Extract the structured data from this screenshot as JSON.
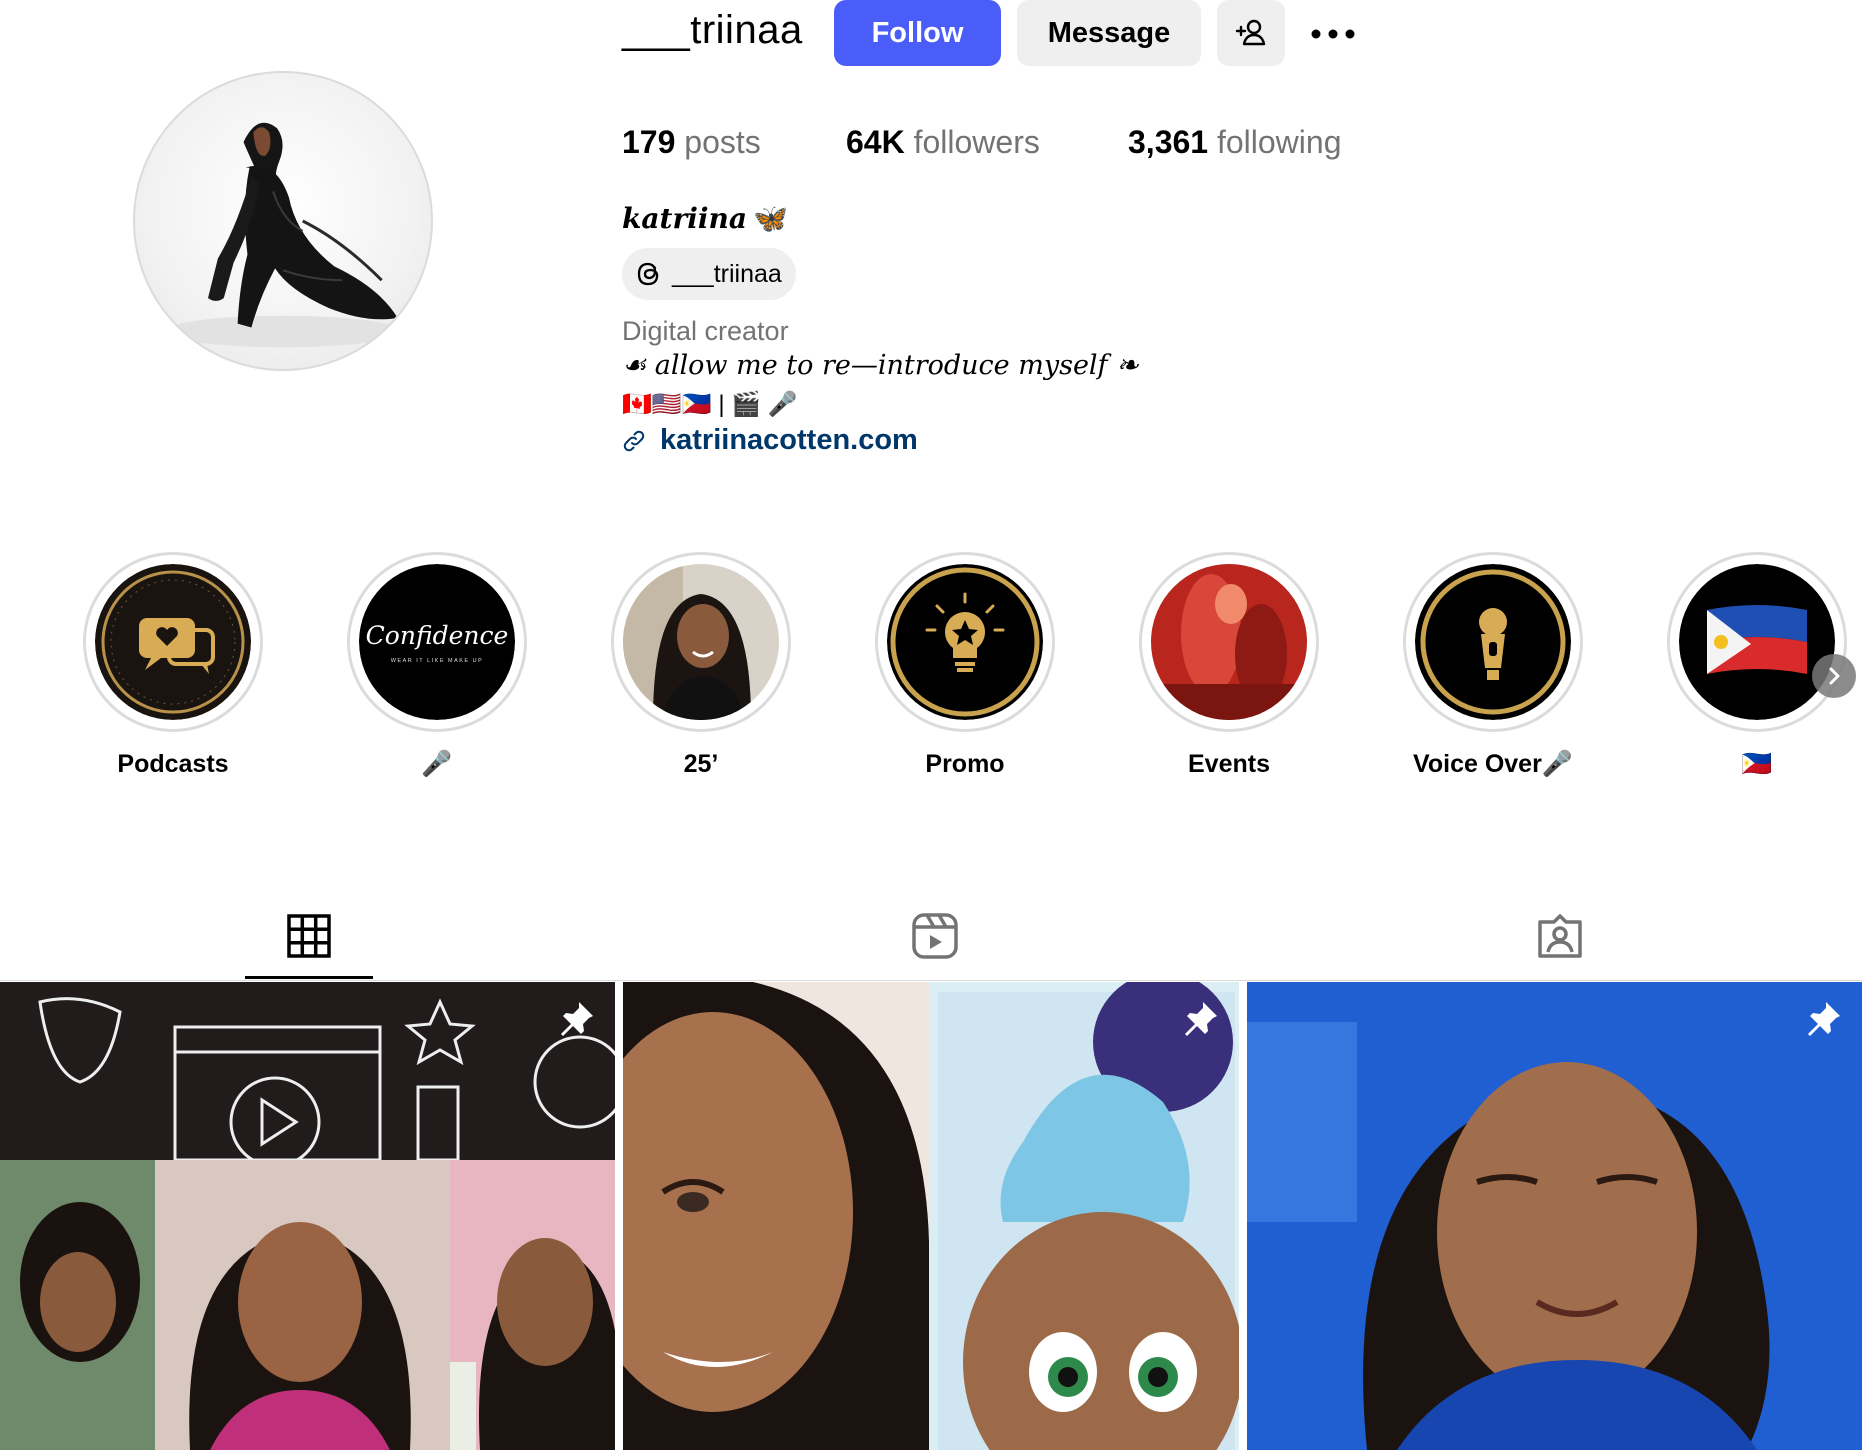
{
  "profile": {
    "username": "___triinaa",
    "follow_label": "Follow",
    "message_label": "Message",
    "stats": {
      "posts_count": "179",
      "posts_label": "posts",
      "followers_count": "64K",
      "followers_label": "followers",
      "following_count": "3,361",
      "following_label": "following"
    },
    "full_name": "katriina",
    "full_name_emoji": "🦋",
    "threads_handle": "___triinaa",
    "category": "Digital creator",
    "bio_line_1": "☙ allow me to re—introduce myself ❧",
    "bio_line_2": "🇨🇦🇺🇸🇵🇭 | 🎬 🎤",
    "website": "katriinacotten.com"
  },
  "highlights": [
    {
      "label": "Podcasts",
      "icon": "podcast-chat-icon"
    },
    {
      "label": "🎤",
      "icon": "confidence-logo",
      "cover_text": "Confidence",
      "cover_subtext": "WEAR IT LIKE MAKE UP"
    },
    {
      "label": "25’",
      "icon": "portrait-photo"
    },
    {
      "label": "Promo",
      "icon": "lightbulb-star-icon"
    },
    {
      "label": "Events",
      "icon": "event-photo"
    },
    {
      "label": "Voice Over🎤",
      "icon": "microphone-icon"
    },
    {
      "label": "🇵🇭",
      "icon": "philippines-flag-icon"
    }
  ],
  "tabs": [
    {
      "name": "posts",
      "icon": "grid-icon",
      "active": true
    },
    {
      "name": "reels",
      "icon": "reels-icon",
      "active": false
    },
    {
      "name": "tagged",
      "icon": "tagged-icon",
      "active": false
    }
  ],
  "posts": [
    {
      "kind": "collage",
      "pinned": true
    },
    {
      "kind": "portrait-and-animated",
      "pinned": true
    },
    {
      "kind": "video-still",
      "pinned": true
    }
  ],
  "colors": {
    "accent": "#4a5df9",
    "link": "#00376b",
    "secondary_text": "#737373",
    "button_bg": "#efefef",
    "border": "#dbdbdb"
  }
}
